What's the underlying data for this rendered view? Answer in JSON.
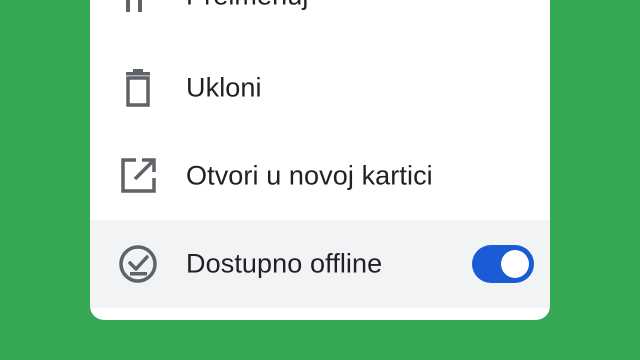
{
  "colors": {
    "background": "#34a853",
    "menu": "#ffffff",
    "highlight_row": "#f1f3f4",
    "text": "#202124",
    "icon": "#5f6368",
    "toggle_on": "#1a5bd6"
  },
  "menu": {
    "items": [
      {
        "label": "Preimenuj",
        "icon": "rename-icon"
      },
      {
        "label": "Ukloni",
        "icon": "trash-icon"
      },
      {
        "label": "Otvori u novoj kartici",
        "icon": "open-in-new-icon"
      },
      {
        "label": "Dostupno offline",
        "icon": "offline-check-icon",
        "toggle_on": true
      }
    ]
  }
}
